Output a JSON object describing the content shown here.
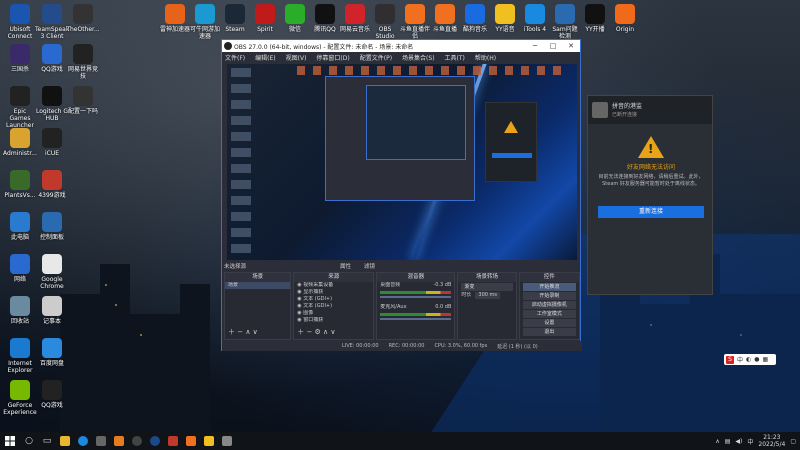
{
  "desktop": {
    "left_icons": [
      {
        "label": "Ubisoft Connect",
        "color": "#1a55b0"
      },
      {
        "label": "TeamSpeak 3 Client",
        "color": "#244c8c"
      },
      {
        "label": "TheOther...",
        "color": "#333"
      },
      {
        "label": "三国杀",
        "color": "#3a2a6a"
      },
      {
        "label": "QQ游戏",
        "color": "#2a6ad0"
      },
      {
        "label": "网易世界竞技",
        "color": "#222"
      },
      {
        "label": "Epic Games Launcher",
        "color": "#222"
      },
      {
        "label": "Logitech G HUB",
        "color": "#111"
      },
      {
        "label": "配置一下吗",
        "color": "#333"
      },
      {
        "label": "Administr...",
        "color": "#d9a330"
      },
      {
        "label": "iCUE",
        "color": "#222"
      },
      {
        "label": "PlantsVs...",
        "color": "#3a6a2a"
      },
      {
        "label": "4399游戏",
        "color": "#c0392b"
      },
      {
        "label": "此电脑",
        "color": "#2a7ad0"
      },
      {
        "label": "控制面板",
        "color": "#2a6ab0"
      },
      {
        "label": "网络",
        "color": "#2a6ad0"
      },
      {
        "label": "Google Chrome",
        "color": "#e8e8e8"
      },
      {
        "label": "回收站",
        "color": "#6a8aa0"
      },
      {
        "label": "记事本",
        "color": "#ccc"
      },
      {
        "label": "Internet Explorer",
        "color": "#1a7ad0"
      },
      {
        "label": "百度网盘",
        "color": "#2a8ae0"
      },
      {
        "label": "GeForce Experience",
        "color": "#76b900"
      },
      {
        "label": "QQ游戏",
        "color": "#222"
      }
    ],
    "top_icons": [
      {
        "label": "雷神加速器",
        "color": "#e8631a"
      },
      {
        "label": "可牛网游加速器",
        "color": "#1a9ad0"
      },
      {
        "label": "Steam",
        "color": "#1b2838"
      },
      {
        "label": "Spirit",
        "color": "#c01a1a"
      },
      {
        "label": "微信",
        "color": "#2aae2a"
      },
      {
        "label": "腾讯QQ",
        "color": "#111"
      },
      {
        "label": "网易云音乐",
        "color": "#d0242a"
      },
      {
        "label": "OBS Studio",
        "color": "#302e31"
      },
      {
        "label": "斗鱼直播伴侣",
        "color": "#f07020"
      },
      {
        "label": "斗鱼直播",
        "color": "#f07020"
      },
      {
        "label": "酷狗音乐",
        "color": "#1a6ae0"
      },
      {
        "label": "YY语音",
        "color": "#f0c020"
      },
      {
        "label": "iTools 4",
        "color": "#1a8ae0"
      },
      {
        "label": "Sam问题检测",
        "color": "#2a6ab0"
      },
      {
        "label": "YY开播",
        "color": "#111"
      },
      {
        "label": "Origin",
        "color": "#f06a1a"
      }
    ]
  },
  "obs": {
    "title": "OBS 27.0.0 (64-bit, windows) - 配置文件: 未命名 - 场景: 未命名",
    "menu": [
      "文件(F)",
      "编辑(E)",
      "视图(V)",
      "停靠窗口(D)",
      "配置文件(P)",
      "场景集合(S)",
      "工具(T)",
      "帮助(H)"
    ],
    "no_source_label": "未选择源",
    "properties_label": "属性",
    "filters_label": "滤镜",
    "docks": {
      "scenes": {
        "title": "场景",
        "items": [
          "场景"
        ]
      },
      "sources": {
        "title": "来源",
        "items": [
          "视频采集设备",
          "显示捕获",
          "文本 (GDI+)",
          "文本 (GDI+)",
          "图像",
          "窗口捕获"
        ]
      },
      "mixer": {
        "title": "混音器",
        "tracks": [
          {
            "name": "桌面音频",
            "db": "-0.3 dB"
          },
          {
            "name": "麦克风/Aux",
            "db": "0.0 dB"
          }
        ]
      },
      "transitions": {
        "title": "场景转场",
        "type": "渐变",
        "duration_label": "时长",
        "duration": "300 ms"
      },
      "controls": {
        "title": "控件",
        "buttons": [
          "开始推流",
          "开始录制",
          "启动虚拟摄像机",
          "工作室模式",
          "设置",
          "退出"
        ]
      }
    },
    "status": {
      "live": "LIVE: 00:00:00",
      "rec": "REC: 00:00:00",
      "cpu": "CPU: 3.0%, 60.00 fps",
      "info": "延迟 (1 秒) (以 0)"
    }
  },
  "steam_dialog": {
    "name": "拼音的港监",
    "sub": "已断开连接",
    "heading": "好友网络无法访问",
    "message": "目前无法连接到好友网络，请稍后重试。此外，Steam 好友服务器可能暂时处于离线状态。",
    "button": "重新连接"
  },
  "taskbar": {
    "time": "21:23",
    "date": "2022/5/4",
    "ime_label": "中"
  }
}
